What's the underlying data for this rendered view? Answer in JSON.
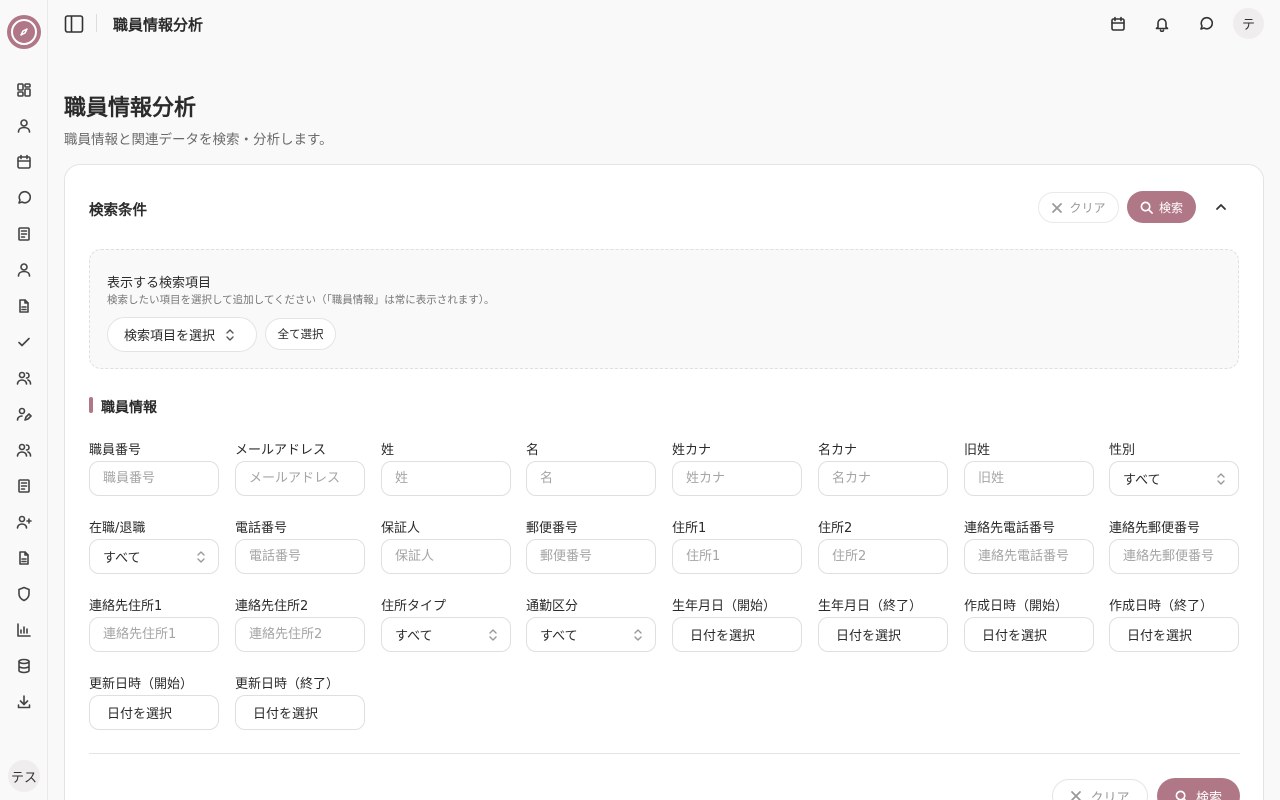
{
  "app": {
    "header_title": "職員情報分析",
    "user_avatar_initial": "テ",
    "sidebar_user_initials": "テス",
    "accent_color": "#b07786"
  },
  "sidebar": {
    "icons": [
      "dashboard-icon",
      "user-icon",
      "calendar-icon",
      "message-icon",
      "document-icon",
      "user-icon",
      "file-icon",
      "check-icon",
      "users-icon",
      "user-edit-icon",
      "users-icon",
      "document-icon",
      "user-plus-icon",
      "file-icon",
      "shield-icon",
      "chart-icon",
      "database-icon",
      "download-icon"
    ]
  },
  "page": {
    "title": "職員情報分析",
    "subtitle": "職員情報と関連データを検索・分析します。"
  },
  "search_card": {
    "title": "検索条件",
    "clear_label": "クリア",
    "search_label": "検索",
    "display_items": {
      "title": "表示する検索項目",
      "description": "検索したい項目を選択して追加してください（「職員情報」は常に表示されます）。",
      "select_button": "検索項目を選択",
      "select_all_button": "全て選択"
    },
    "section_title": "職員情報",
    "fields": [
      {
        "label": "職員番号",
        "type": "text",
        "placeholder": "職員番号"
      },
      {
        "label": "メールアドレス",
        "type": "text",
        "placeholder": "メールアドレス"
      },
      {
        "label": "姓",
        "type": "text",
        "placeholder": "姓"
      },
      {
        "label": "名",
        "type": "text",
        "placeholder": "名"
      },
      {
        "label": "姓カナ",
        "type": "text",
        "placeholder": "姓カナ"
      },
      {
        "label": "名カナ",
        "type": "text",
        "placeholder": "名カナ"
      },
      {
        "label": "旧姓",
        "type": "text",
        "placeholder": "旧姓"
      },
      {
        "label": "性別",
        "type": "select",
        "value": "すべて"
      },
      {
        "label": "在職/退職",
        "type": "select",
        "value": "すべて"
      },
      {
        "label": "電話番号",
        "type": "text",
        "placeholder": "電話番号"
      },
      {
        "label": "保証人",
        "type": "text",
        "placeholder": "保証人"
      },
      {
        "label": "郵便番号",
        "type": "text",
        "placeholder": "郵便番号"
      },
      {
        "label": "住所1",
        "type": "text",
        "placeholder": "住所1"
      },
      {
        "label": "住所2",
        "type": "text",
        "placeholder": "住所2"
      },
      {
        "label": "連絡先電話番号",
        "type": "text",
        "placeholder": "連絡先電話番号"
      },
      {
        "label": "連絡先郵便番号",
        "type": "text",
        "placeholder": "連絡先郵便番号"
      },
      {
        "label": "連絡先住所1",
        "type": "text",
        "placeholder": "連絡先住所1"
      },
      {
        "label": "連絡先住所2",
        "type": "text",
        "placeholder": "連絡先住所2"
      },
      {
        "label": "住所タイプ",
        "type": "select",
        "value": "すべて"
      },
      {
        "label": "通勤区分",
        "type": "select",
        "value": "すべて"
      },
      {
        "label": "生年月日（開始）",
        "type": "date",
        "value": "日付を選択"
      },
      {
        "label": "生年月日（終了）",
        "type": "date",
        "value": "日付を選択"
      },
      {
        "label": "作成日時（開始）",
        "type": "date",
        "value": "日付を選択"
      },
      {
        "label": "作成日時（終了）",
        "type": "date",
        "value": "日付を選択"
      },
      {
        "label": "更新日時（開始）",
        "type": "date",
        "value": "日付を選択"
      },
      {
        "label": "更新日時（終了）",
        "type": "date",
        "value": "日付を選択"
      }
    ]
  }
}
